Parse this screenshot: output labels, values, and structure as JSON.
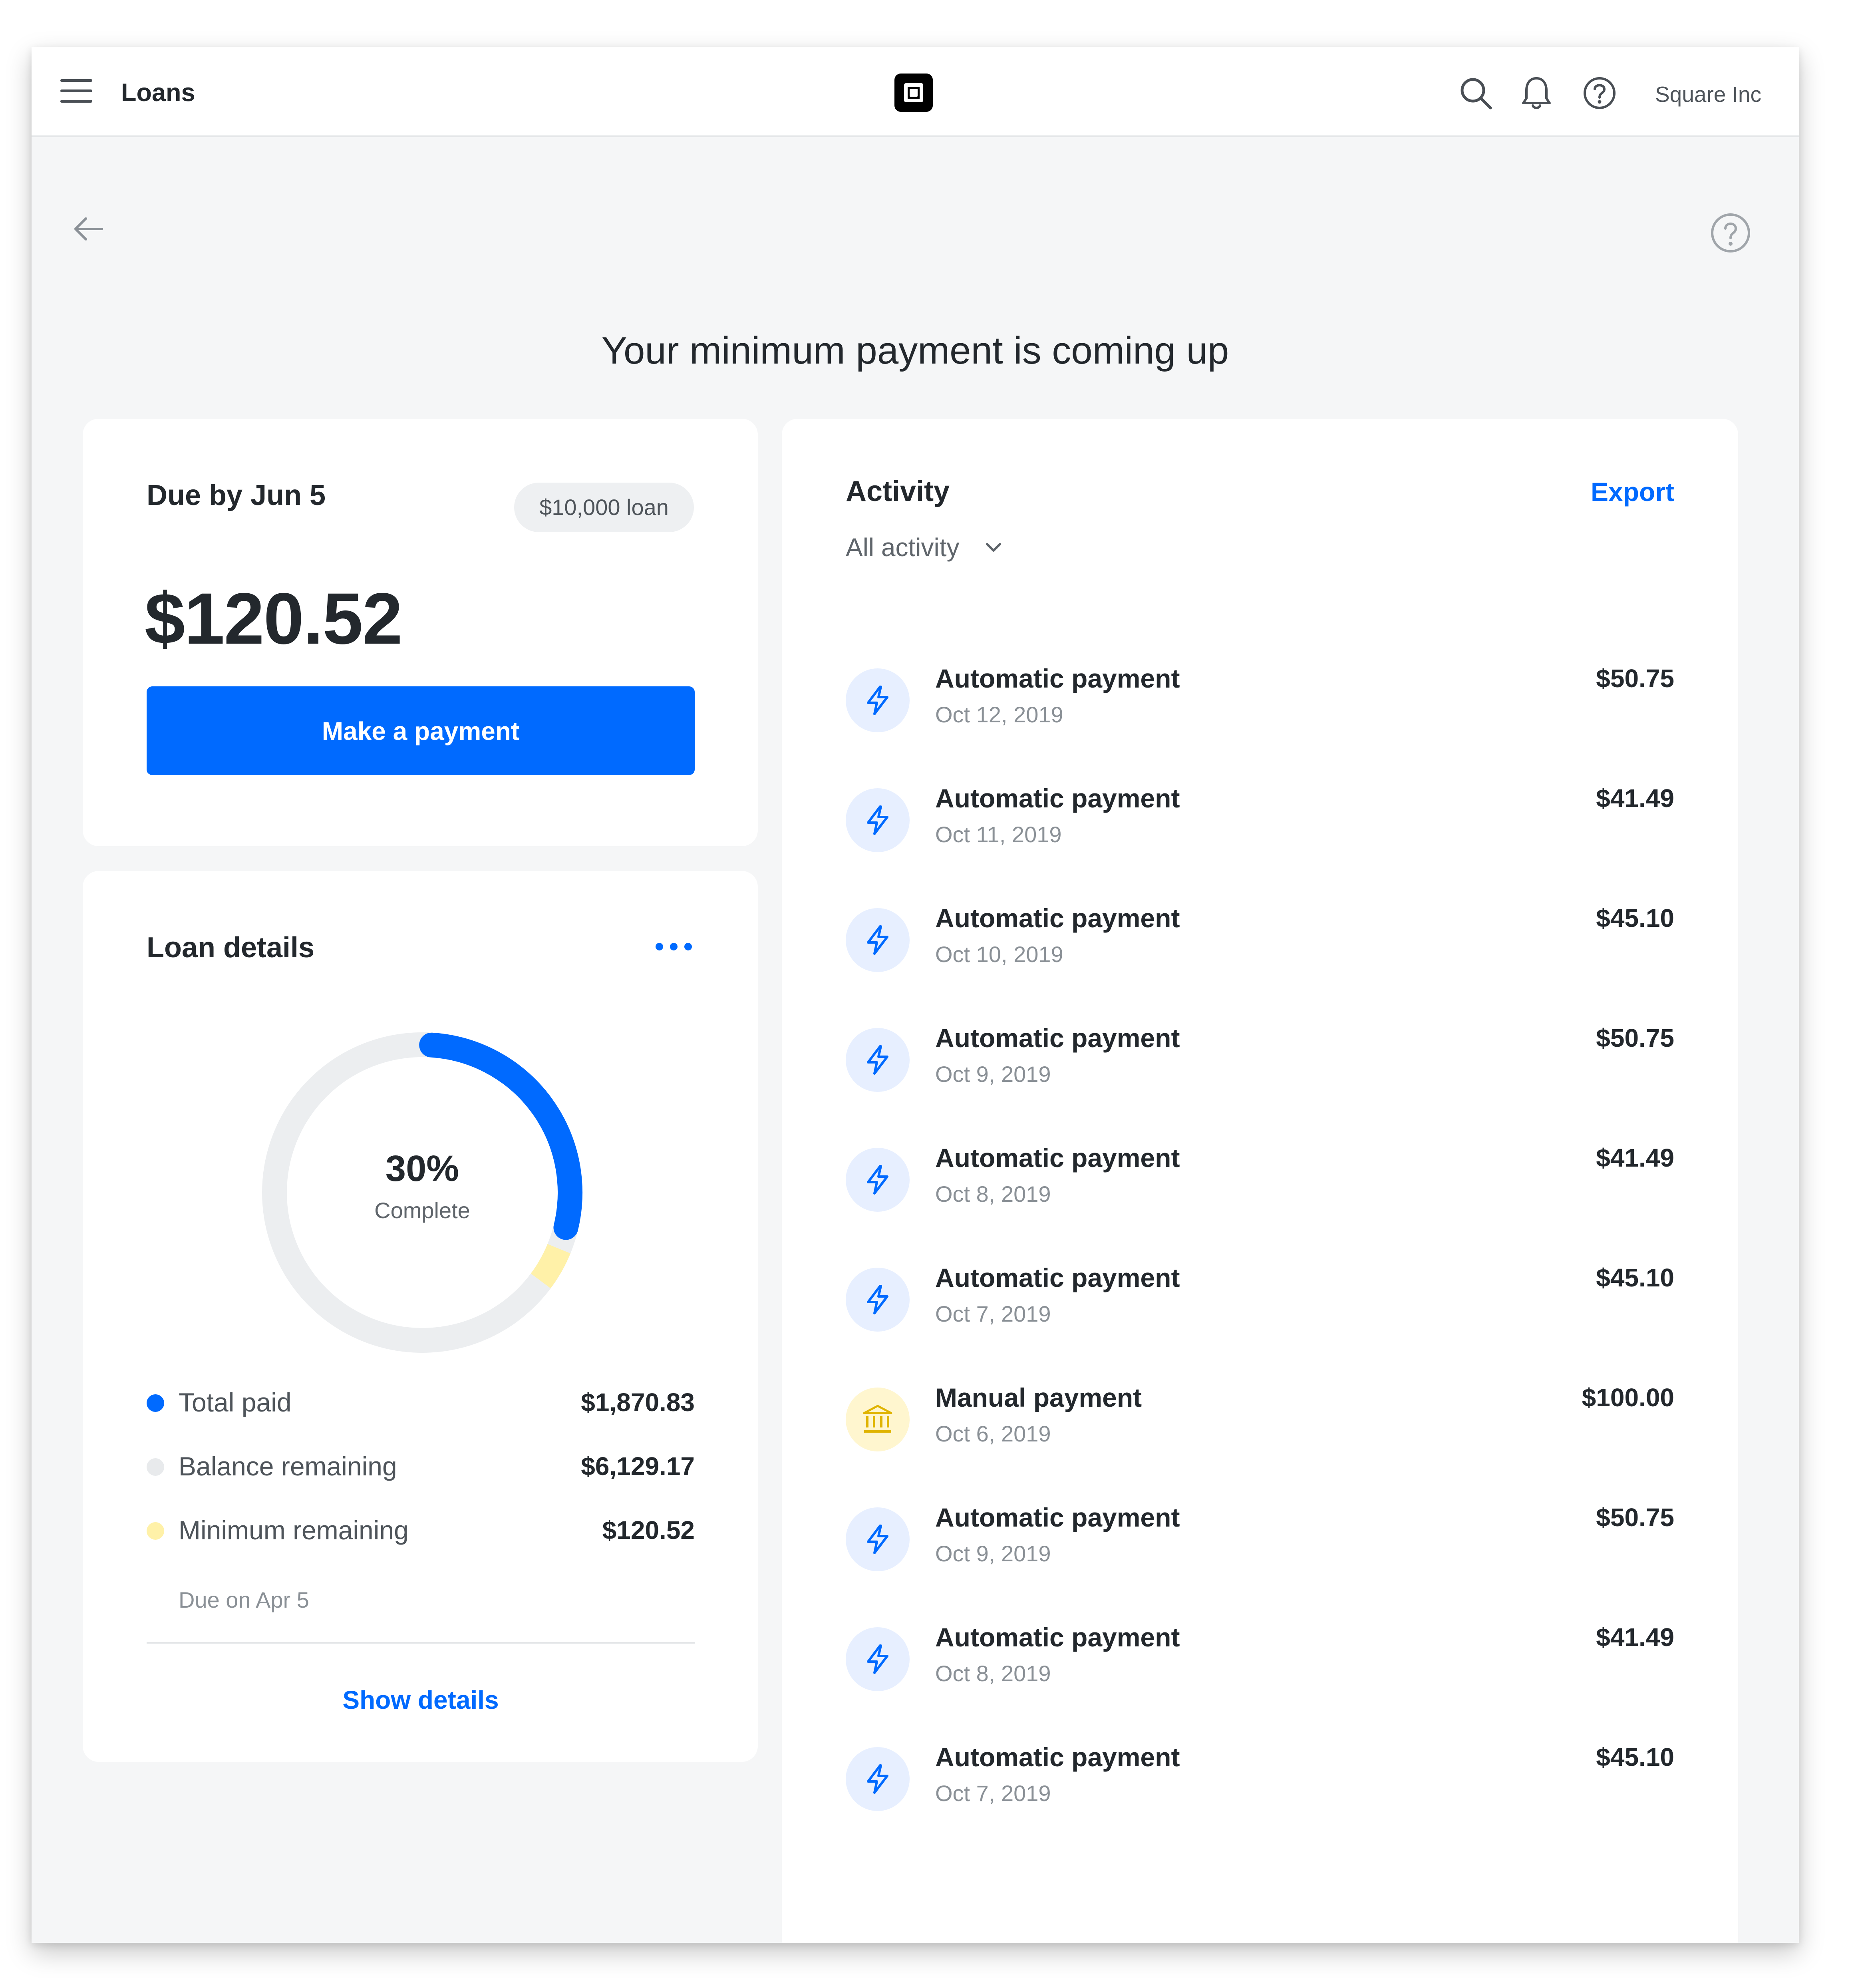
{
  "topbar": {
    "title": "Loans",
    "account_name": "Square Inc",
    "icons": [
      "menu-icon",
      "square-logo",
      "search-icon",
      "bell-icon",
      "help-icon"
    ]
  },
  "page": {
    "headline": "Your minimum payment is coming up"
  },
  "due_card": {
    "title": "Due by Jun 5",
    "loan_badge": "$10,000 loan",
    "amount": "$120.52",
    "button_label": "Make a payment"
  },
  "loan_details": {
    "title": "Loan details",
    "progress_percent": "30%",
    "progress_fraction": 0.3,
    "minimum_fraction": 0.04,
    "progress_label": "Complete",
    "legend": [
      {
        "label": "Total paid",
        "value": "$1,870.83",
        "color": "#006aff"
      },
      {
        "label": "Balance remaining",
        "value": "$6,129.17",
        "color": "#e8eaec"
      },
      {
        "label": "Minimum remaining",
        "value": "$120.52",
        "color": "#fff1a8"
      }
    ],
    "minimum_sub": "Due on Apr 5",
    "show_details": "Show details"
  },
  "activity": {
    "title": "Activity",
    "filter": "All activity",
    "export_label": "Export",
    "items": [
      {
        "type": "automatic",
        "name": "Automatic payment",
        "date": "Oct 12, 2019",
        "amount": "$50.75"
      },
      {
        "type": "automatic",
        "name": "Automatic payment",
        "date": "Oct 11, 2019",
        "amount": "$41.49"
      },
      {
        "type": "automatic",
        "name": "Automatic payment",
        "date": "Oct 10, 2019",
        "amount": "$45.10"
      },
      {
        "type": "automatic",
        "name": "Automatic payment",
        "date": "Oct 9, 2019",
        "amount": "$50.75"
      },
      {
        "type": "automatic",
        "name": "Automatic payment",
        "date": "Oct 8, 2019",
        "amount": "$41.49"
      },
      {
        "type": "automatic",
        "name": "Automatic payment",
        "date": "Oct 7, 2019",
        "amount": "$45.10"
      },
      {
        "type": "manual",
        "name": "Manual payment",
        "date": "Oct 6, 2019",
        "amount": "$100.00"
      },
      {
        "type": "automatic",
        "name": "Automatic payment",
        "date": "Oct 9, 2019",
        "amount": "$50.75"
      },
      {
        "type": "automatic",
        "name": "Automatic payment",
        "date": "Oct 8, 2019",
        "amount": "$41.49"
      },
      {
        "type": "automatic",
        "name": "Automatic payment",
        "date": "Oct 7, 2019",
        "amount": "$45.10"
      }
    ]
  },
  "colors": {
    "accent": "#006aff",
    "minimum": "#fff1a8",
    "track": "#eceef0"
  }
}
